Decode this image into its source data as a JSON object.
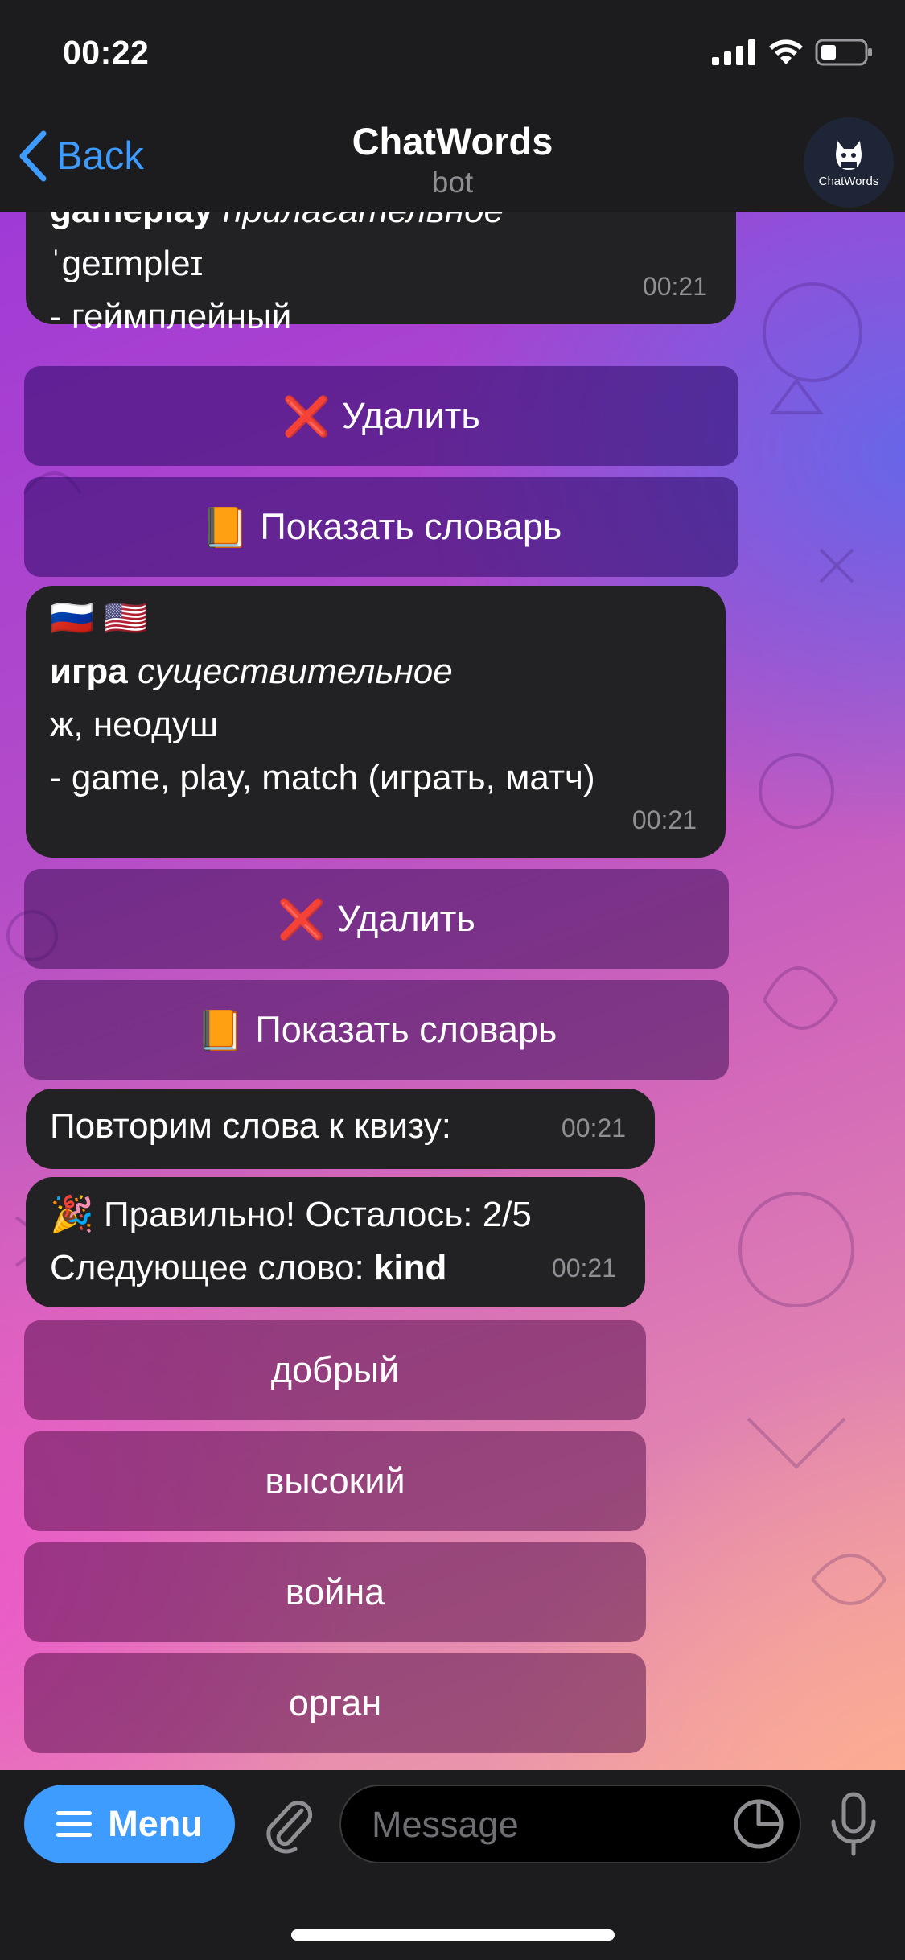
{
  "status_bar": {
    "time": "00:22",
    "icons": [
      "signal-icon",
      "wifi-icon",
      "battery-icon"
    ]
  },
  "header": {
    "back_label": "Back",
    "title": "ChatWords",
    "subtitle": "bot",
    "avatar_label": "ChatWords"
  },
  "messages": [
    {
      "id": "gameplay",
      "lines": [
        {
          "bold": "gameplay",
          "italic": " прилагательное"
        },
        {
          "text": "ˈgeɪmpleɪ"
        },
        {
          "text": "- геймплейный"
        }
      ],
      "time": "00:21"
    },
    {
      "id": "igra",
      "flags": "🇷🇺 🇺🇸",
      "lines": [
        {
          "bold": "игра",
          "italic": " существительное"
        },
        {
          "text": "ж, неодуш"
        },
        {
          "text": "- game, play, match (играть, матч)"
        }
      ],
      "time": "00:21"
    },
    {
      "id": "repeat",
      "text": "Повторим слова к квизу:",
      "time": "00:21"
    },
    {
      "id": "quiz",
      "line1": "🎉 Правильно! Осталось: 2/5",
      "line2_prefix": "Следующее слово: ",
      "line2_bold": "kind",
      "time": "00:21"
    }
  ],
  "keyboards": {
    "delete_label": "Удалить",
    "delete_icon": "❌",
    "dictionary_label": "Показать словарь",
    "dictionary_icon": "📙",
    "answers": [
      "добрый",
      "высокий",
      "война",
      "орган"
    ]
  },
  "composer": {
    "menu_label": "Menu",
    "placeholder": "Message"
  },
  "colors": {
    "accent": "#3e9bff",
    "bubble": "#222224",
    "bar": "#1c1c1e"
  }
}
